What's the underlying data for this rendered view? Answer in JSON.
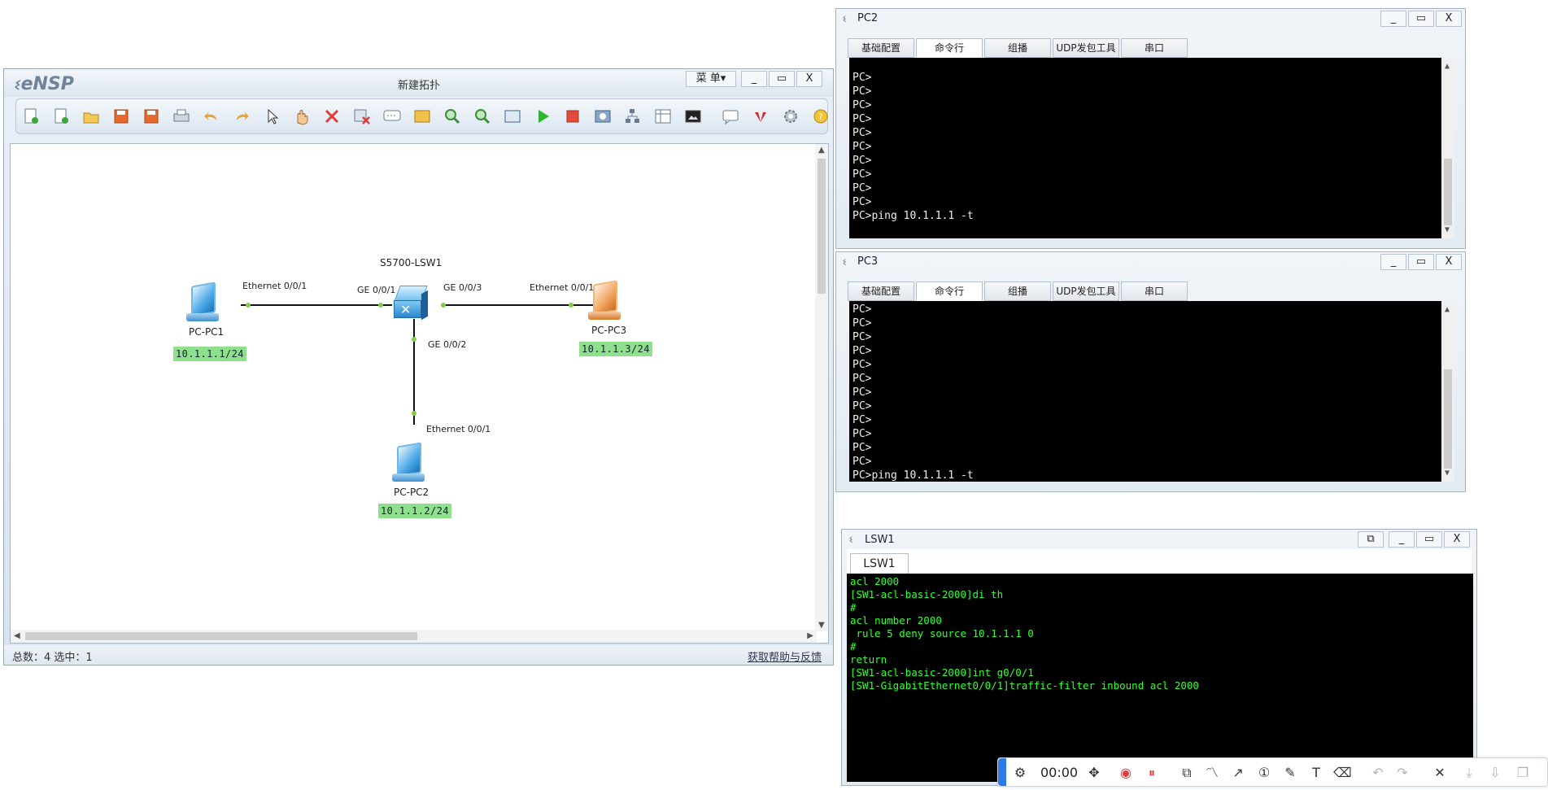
{
  "ensp": {
    "logo": "eNSP",
    "title": "新建拓扑",
    "menu": "菜 单▾",
    "status_left": "总数：4 选中：1",
    "status_right": "获取帮助与反馈"
  },
  "window_buttons": {
    "minimize": "_",
    "maximize": "▭",
    "close": "X"
  },
  "topology": {
    "switch_name": "S5700-LSW1",
    "devices": [
      {
        "name": "PC-PC1",
        "ip": "10.1.1.1/24"
      },
      {
        "name": "PC-PC2",
        "ip": "10.1.1.2/24"
      },
      {
        "name": "PC-PC3",
        "ip": "10.1.1.3/24"
      }
    ],
    "ports": {
      "pc1_eth": "Ethernet 0/0/1",
      "sw_ge1": "GE 0/0/1",
      "sw_ge3": "GE 0/0/3",
      "pc3_eth": "Ethernet 0/0/1",
      "sw_ge2": "GE 0/0/2",
      "pc2_eth": "Ethernet 0/0/1"
    }
  },
  "pc_tabs": [
    "基础配置",
    "命令行",
    "组播",
    "UDP发包工具",
    "串口"
  ],
  "pc2": {
    "title": "PC2",
    "lines": [
      "PC>",
      "PC>",
      "PC>",
      "PC>",
      "PC>",
      "PC>",
      "PC>",
      "PC>",
      "PC>",
      "PC>",
      "PC>ping 10.1.1.1 -t"
    ]
  },
  "pc3": {
    "title": "PC3",
    "lines": [
      "PC>",
      "PC>",
      "PC>",
      "PC>",
      "PC>",
      "PC>",
      "PC>",
      "PC>",
      "PC>",
      "PC>",
      "PC>",
      "PC>",
      "PC>ping 10.1.1.1 -t"
    ]
  },
  "lsw1": {
    "title": "LSW1",
    "tab": "LSW1",
    "lines": [
      "acl 2000",
      "[SW1-acl-basic-2000]di th",
      "#",
      "acl number 2000",
      " rule 5 deny source 10.1.1.1 0",
      "#",
      "return",
      "[SW1-acl-basic-2000]int g0/0/1",
      "[SW1-GigabitEthernet0/0/1]traffic-filter inbound acl 2000"
    ]
  },
  "recorder": {
    "time": "00:00",
    "icons": [
      "gear-icon",
      "move-icon",
      "record-icon",
      "pause-icon",
      "shapes-icon",
      "polyline-icon",
      "arrow-icon",
      "number-icon",
      "pen-icon",
      "text-icon",
      "eraser-icon",
      "undo-icon",
      "redo-icon",
      "close-icon",
      "download-icon",
      "save-icon",
      "copy-icon"
    ]
  },
  "colors": {
    "console_bg": "#000000",
    "switch_console_text": "#33ff33",
    "ip_label_bg": "#8fe08c",
    "port_dot": "#7dcf45",
    "recorder_accent": "#2f7be5"
  }
}
